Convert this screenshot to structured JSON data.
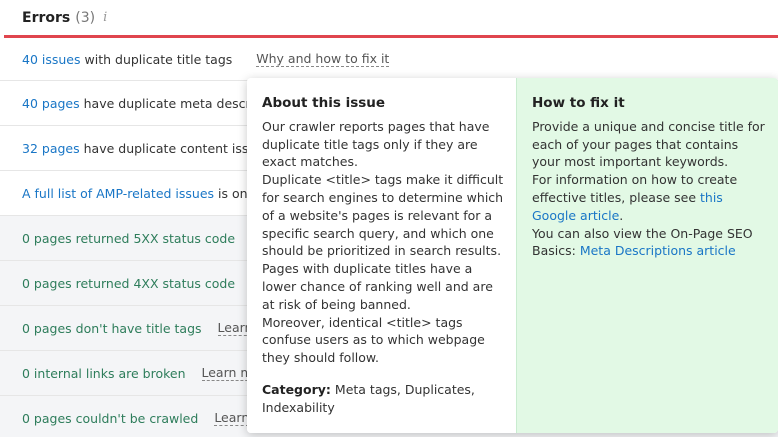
{
  "header": {
    "title": "Errors",
    "count": "(3)",
    "info_icon": "i"
  },
  "rows": [
    {
      "link": "40 issues",
      "text": "with duplicate title tags",
      "action": "Why and how to fix it"
    },
    {
      "link": "40 pages",
      "text": "have duplicate meta descrip"
    },
    {
      "link": "32 pages",
      "text": "have duplicate content issu"
    },
    {
      "link": "A full list of AMP-related issues",
      "text": "is only"
    },
    {
      "text": "0 pages returned 5XX status code"
    },
    {
      "text": "0 pages returned 4XX status code"
    },
    {
      "text": "0 pages don't have title tags",
      "action": "Learn"
    },
    {
      "text": "0 internal links are broken",
      "action": "Learn m"
    },
    {
      "text": "0 pages couldn't be crawled",
      "action": "Learn"
    }
  ],
  "popup": {
    "about": {
      "heading": "About this issue",
      "p1": "Our crawler reports pages that have duplicate title tags only if they are exact matches.",
      "p2": "Duplicate <title> tags make it difficult for search engines to determine which of a website's pages is relevant for a specific search query, and which one should be prioritized in search results.",
      "p3": "Pages with duplicate titles have a lower chance of ranking well and are at risk of being banned.",
      "p4": "Moreover, identical <title> tags confuse users as to which webpage they should follow.",
      "category_label": "Category:",
      "category_value": "Meta tags, Duplicates, Indexability"
    },
    "fix": {
      "heading": "How to fix it",
      "p1": "Provide a unique and concise title for each of your pages that contains your most important keywords.",
      "p2_text": "For information on how to create effective titles, please see",
      "p2_link": "this Google article",
      "p2_end": ".",
      "p3_text": "You can also view the On-Page SEO Basics:",
      "p3_link": "Meta Descriptions article"
    }
  }
}
